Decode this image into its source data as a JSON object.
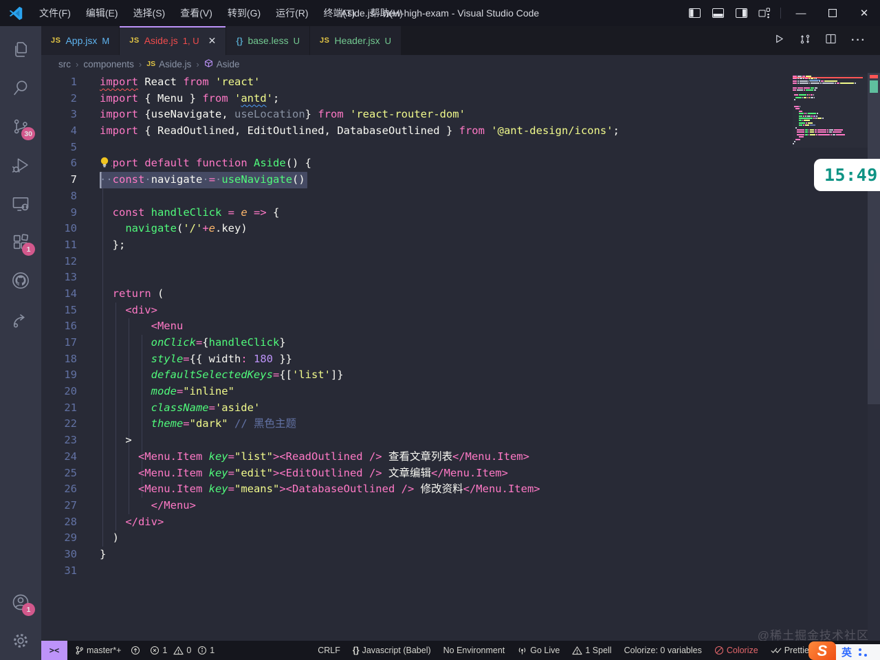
{
  "titlebar": {
    "title": "Aside.js - new-high-exam - Visual Studio Code",
    "menus": [
      "文件(F)",
      "编辑(E)",
      "选择(S)",
      "查看(V)",
      "转到(G)",
      "运行(R)",
      "终端(T)",
      "帮助(H)"
    ]
  },
  "activitybar": {
    "top": [
      {
        "name": "explorer"
      },
      {
        "name": "search"
      },
      {
        "name": "source-control",
        "badge": "30"
      },
      {
        "name": "run-debug"
      },
      {
        "name": "remote-explorer"
      },
      {
        "name": "extensions",
        "badge": "1"
      },
      {
        "name": "github"
      },
      {
        "name": "live-share"
      }
    ],
    "bottom": [
      {
        "name": "account",
        "badge": "1"
      },
      {
        "name": "settings"
      }
    ]
  },
  "tabs": [
    {
      "icon": "js",
      "label": "App.jsx",
      "deco": "M",
      "color": "c-blue",
      "active": false,
      "close": false
    },
    {
      "icon": "js",
      "label": "Aside.js",
      "deco": "1, U",
      "color": "c-red",
      "active": true,
      "close": true
    },
    {
      "icon": "braces",
      "label": "base.less",
      "deco": "U",
      "color": "c-green",
      "active": false,
      "close": false
    },
    {
      "icon": "js",
      "label": "Header.jsx",
      "deco": "U",
      "color": "c-green",
      "active": false,
      "close": false
    }
  ],
  "editor_actions": [
    "run",
    "open-changes",
    "split-editor",
    "more-actions"
  ],
  "breadcrumb": [
    {
      "label": "src"
    },
    {
      "label": "components"
    },
    {
      "label": "Aside.js",
      "icon": "js"
    },
    {
      "label": "Aside",
      "icon": "cube"
    }
  ],
  "code": {
    "selected_line": 7,
    "lines": [
      {
        "n": 1,
        "i": 0,
        "t": [
          [
            "import",
            "k e1"
          ],
          [
            " ",
            "w"
          ],
          [
            "React",
            "w"
          ],
          [
            " ",
            "w"
          ],
          [
            "from",
            "k"
          ],
          [
            " ",
            "w"
          ],
          [
            "'react'",
            "s"
          ]
        ]
      },
      {
        "n": 2,
        "i": 0,
        "t": [
          [
            "import",
            "k"
          ],
          [
            " { ",
            "w"
          ],
          [
            "Menu",
            "w"
          ],
          [
            " } ",
            "w"
          ],
          [
            "from",
            "k"
          ],
          [
            " ",
            "w"
          ],
          [
            "'",
            "s"
          ],
          [
            "antd",
            "s e2"
          ],
          [
            "'",
            "s"
          ],
          [
            ";",
            "w"
          ]
        ]
      },
      {
        "n": 3,
        "i": 0,
        "t": [
          [
            "import",
            "k"
          ],
          [
            " {",
            "w"
          ],
          [
            "useNavigate",
            "w"
          ],
          [
            ", ",
            "w"
          ],
          [
            "useLocation",
            "u"
          ],
          [
            "} ",
            "w"
          ],
          [
            "from",
            "k"
          ],
          [
            " ",
            "w"
          ],
          [
            "'react-router-dom'",
            "s"
          ]
        ]
      },
      {
        "n": 4,
        "i": 0,
        "t": [
          [
            "import",
            "k"
          ],
          [
            " { ",
            "w"
          ],
          [
            "ReadOutlined",
            "w"
          ],
          [
            ", ",
            "w"
          ],
          [
            "EditOutlined",
            "w"
          ],
          [
            ", ",
            "w"
          ],
          [
            "DatabaseOutlined",
            "w"
          ],
          [
            " } ",
            "w"
          ],
          [
            "from",
            "k"
          ],
          [
            " ",
            "w"
          ],
          [
            "'@ant-design/icons'",
            "s"
          ],
          [
            ";",
            "w"
          ]
        ]
      },
      {
        "n": 5,
        "i": 0,
        "t": []
      },
      {
        "n": 6,
        "i": 0,
        "bulb": true,
        "t": [
          [
            "export",
            "k"
          ],
          [
            " ",
            "w"
          ],
          [
            "default",
            "k"
          ],
          [
            " ",
            "w"
          ],
          [
            "function",
            "k"
          ],
          [
            " ",
            "w"
          ],
          [
            "Aside",
            "g"
          ],
          [
            "() {",
            "w"
          ]
        ]
      },
      {
        "n": 7,
        "i": 0,
        "sel": true,
        "t": [
          [
            "··",
            "d"
          ],
          [
            "const",
            "k"
          ],
          [
            "·",
            "d"
          ],
          [
            "navigate",
            "w"
          ],
          [
            "·",
            "d"
          ],
          [
            "=",
            "k"
          ],
          [
            "·",
            "d"
          ],
          [
            "useNavigate",
            "g"
          ],
          [
            "()",
            "w"
          ]
        ]
      },
      {
        "n": 8,
        "i": 0,
        "t": []
      },
      {
        "n": 9,
        "i": 2,
        "t": [
          [
            "const",
            "k"
          ],
          [
            " ",
            "w"
          ],
          [
            "handleClick",
            "g"
          ],
          [
            " ",
            "w"
          ],
          [
            "=",
            "k"
          ],
          [
            " ",
            "w"
          ],
          [
            "e",
            "o"
          ],
          [
            " ",
            "w"
          ],
          [
            "=>",
            "k"
          ],
          [
            " {",
            "w"
          ]
        ]
      },
      {
        "n": 10,
        "i": 4,
        "t": [
          [
            "navigate",
            "g"
          ],
          [
            "(",
            "w"
          ],
          [
            "'/'",
            "s"
          ],
          [
            "+",
            "k"
          ],
          [
            "e",
            "o"
          ],
          [
            ".key",
            "w"
          ],
          [
            ")",
            "w"
          ]
        ]
      },
      {
        "n": 11,
        "i": 2,
        "t": [
          [
            "};",
            "w"
          ]
        ]
      },
      {
        "n": 12,
        "i": 0,
        "t": []
      },
      {
        "n": 13,
        "i": 0,
        "t": []
      },
      {
        "n": 14,
        "i": 2,
        "t": [
          [
            "return",
            "k"
          ],
          [
            " (",
            "w"
          ]
        ]
      },
      {
        "n": 15,
        "i": 4,
        "t": [
          [
            "<div>",
            "k"
          ]
        ]
      },
      {
        "n": 16,
        "i": 8,
        "t": [
          [
            "<Menu",
            "k"
          ]
        ]
      },
      {
        "n": 17,
        "i": 8,
        "t": [
          [
            "onClick",
            "gi"
          ],
          [
            "=",
            "k"
          ],
          [
            "{",
            "w"
          ],
          [
            "handleClick",
            "g"
          ],
          [
            "}",
            "w"
          ]
        ]
      },
      {
        "n": 18,
        "i": 8,
        "t": [
          [
            "style",
            "gi"
          ],
          [
            "=",
            "k"
          ],
          [
            "{{ ",
            "w"
          ],
          [
            "width",
            "w"
          ],
          [
            ":",
            "k"
          ],
          [
            " ",
            "w"
          ],
          [
            "180",
            "n"
          ],
          [
            " }}",
            "w"
          ]
        ]
      },
      {
        "n": 19,
        "i": 8,
        "t": [
          [
            "defaultSelectedKeys",
            "gi"
          ],
          [
            "=",
            "k"
          ],
          [
            "{[",
            "w"
          ],
          [
            "'list'",
            "s"
          ],
          [
            "]}",
            "w"
          ]
        ]
      },
      {
        "n": 20,
        "i": 8,
        "t": [
          [
            "mode",
            "gi"
          ],
          [
            "=",
            "k"
          ],
          [
            "\"inline\"",
            "s"
          ]
        ]
      },
      {
        "n": 21,
        "i": 8,
        "t": [
          [
            "className",
            "gi"
          ],
          [
            "=",
            "k"
          ],
          [
            "'aside'",
            "s"
          ]
        ]
      },
      {
        "n": 22,
        "i": 8,
        "t": [
          [
            "theme",
            "gi"
          ],
          [
            "=",
            "k"
          ],
          [
            "\"dark\"",
            "s"
          ],
          [
            " ",
            "w"
          ],
          [
            "// 黑色主题",
            "c"
          ]
        ]
      },
      {
        "n": 23,
        "i": 4,
        "t": [
          [
            ">",
            "w"
          ]
        ]
      },
      {
        "n": 24,
        "i": 6,
        "t": [
          [
            "<Menu.Item",
            "k"
          ],
          [
            " ",
            "w"
          ],
          [
            "key",
            "gi"
          ],
          [
            "=",
            "k"
          ],
          [
            "\"list\"",
            "s"
          ],
          [
            "><",
            "k"
          ],
          [
            "ReadOutlined",
            "k"
          ],
          [
            " />",
            "k"
          ],
          [
            " 查看文章列表",
            "w"
          ],
          [
            "</Menu.Item>",
            "k"
          ]
        ]
      },
      {
        "n": 25,
        "i": 6,
        "t": [
          [
            "<Menu.Item",
            "k"
          ],
          [
            " ",
            "w"
          ],
          [
            "key",
            "gi"
          ],
          [
            "=",
            "k"
          ],
          [
            "\"edit\"",
            "s"
          ],
          [
            "><",
            "k"
          ],
          [
            "EditOutlined",
            "k"
          ],
          [
            " />",
            "k"
          ],
          [
            " 文章编辑",
            "w"
          ],
          [
            "</Menu.Item>",
            "k"
          ]
        ]
      },
      {
        "n": 26,
        "i": 6,
        "t": [
          [
            "<Menu.Item",
            "k"
          ],
          [
            " ",
            "w"
          ],
          [
            "key",
            "gi"
          ],
          [
            "=",
            "k"
          ],
          [
            "\"means\"",
            "s"
          ],
          [
            "><",
            "k"
          ],
          [
            "DatabaseOutlined",
            "k"
          ],
          [
            " />",
            "k"
          ],
          [
            " 修改资料",
            "w"
          ],
          [
            "</Menu.Item>",
            "k"
          ]
        ]
      },
      {
        "n": 27,
        "i": 8,
        "t": [
          [
            "</Menu>",
            "k"
          ]
        ]
      },
      {
        "n": 28,
        "i": 4,
        "t": [
          [
            "</div>",
            "k"
          ]
        ]
      },
      {
        "n": 29,
        "i": 2,
        "t": [
          [
            ")",
            "w"
          ]
        ]
      },
      {
        "n": 30,
        "i": 0,
        "t": [
          [
            "}",
            "w"
          ]
        ]
      },
      {
        "n": 31,
        "i": 0,
        "t": []
      }
    ]
  },
  "overlay": {
    "timer": "15:49"
  },
  "watermark": "@稀土掘金技术社区",
  "statusbar": {
    "remote_label": "><",
    "branch": "master*+",
    "errors": "1",
    "warnings": "0",
    "infos": "1",
    "eol": "CRLF",
    "language_braces": "{}",
    "language": "Javascript (Babel)",
    "environment": "No Environment",
    "golive": "Go Live",
    "spell": "1 Spell",
    "colorize_vars": "Colorize: 0 variables",
    "colorize": "Colorize",
    "prettier": "Prettier"
  },
  "ime": {
    "logo": "S",
    "mode": "英"
  }
}
